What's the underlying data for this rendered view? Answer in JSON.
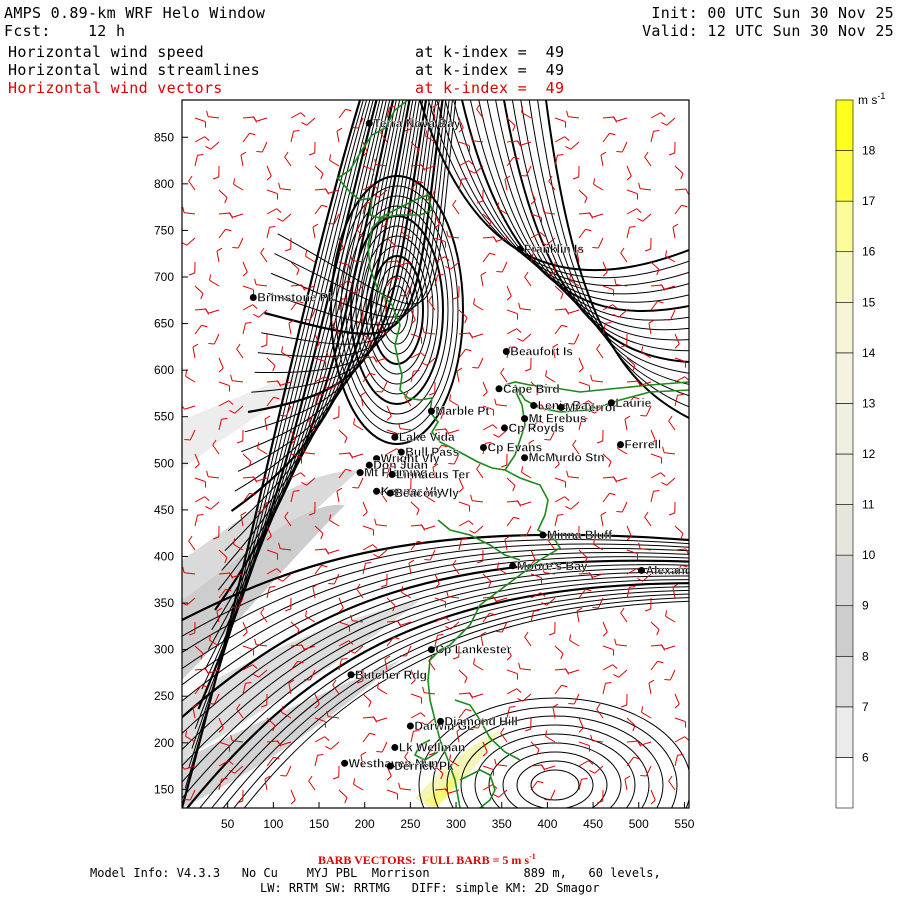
{
  "header": {
    "model_title": "AMPS 0.89-km WRF Helo Window",
    "forecast_label": "Fcst:    12 h",
    "init_label": "Init: 00 UTC Sun 30 Nov 25",
    "valid_label": "Valid: 12 UTC Sun 30 Nov 25",
    "fields": [
      {
        "name": "Horizontal wind speed",
        "level": "at k-index =  49",
        "color": "#000000"
      },
      {
        "name": "Horizontal wind streamlines",
        "level": "at k-index =  49",
        "color": "#000000"
      },
      {
        "name": "Horizontal wind vectors",
        "level": "at k-index =  49",
        "color": "#e00000"
      }
    ]
  },
  "map": {
    "x_ticks": [
      "50",
      "100",
      "150",
      "200",
      "250",
      "300",
      "350",
      "400",
      "450",
      "500",
      "550"
    ],
    "y_ticks": [
      "150",
      "200",
      "250",
      "300",
      "350",
      "400",
      "450",
      "500",
      "550",
      "600",
      "650",
      "700",
      "750",
      "800",
      "850"
    ],
    "x_range": [
      0,
      555
    ],
    "y_range": [
      130,
      890
    ],
    "coastline_color": "#1a8a1a",
    "barb_color": "#e00000",
    "streamline_color": "#000000",
    "places": [
      {
        "name": "Terra Nova Bay",
        "x": 205,
        "y": 865
      },
      {
        "name": "Franklin Is",
        "x": 370,
        "y": 730
      },
      {
        "name": "Brimstone Pk",
        "x": 78,
        "y": 678
      },
      {
        "name": "Beaufort Is",
        "x": 355,
        "y": 620
      },
      {
        "name": "Cape Bird",
        "x": 347,
        "y": 580
      },
      {
        "name": "Lenie Bay",
        "x": 385,
        "y": 562
      },
      {
        "name": "Mt Terror",
        "x": 415,
        "y": 560
      },
      {
        "name": "Laurie",
        "x": 470,
        "y": 565
      },
      {
        "name": "Marble Pt",
        "x": 273,
        "y": 556
      },
      {
        "name": "Mt Erebus",
        "x": 375,
        "y": 548
      },
      {
        "name": "Cp Royds",
        "x": 353,
        "y": 538
      },
      {
        "name": "Lake Vida",
        "x": 233,
        "y": 528
      },
      {
        "name": "Ferrell",
        "x": 480,
        "y": 520
      },
      {
        "name": "Cp Evans",
        "x": 330,
        "y": 517
      },
      {
        "name": "Bull Pass",
        "x": 240,
        "y": 512
      },
      {
        "name": "McMurdo Stn",
        "x": 375,
        "y": 506
      },
      {
        "name": "Wright Vly",
        "x": 213,
        "y": 505
      },
      {
        "name": "Don Juan",
        "x": 205,
        "y": 498
      },
      {
        "name": "Mt Fleming",
        "x": 195,
        "y": 490
      },
      {
        "name": "Linnaeus Ter",
        "x": 230,
        "y": 488
      },
      {
        "name": "Kennar Vly",
        "x": 213,
        "y": 470
      },
      {
        "name": "Beacon Vly",
        "x": 228,
        "y": 468
      },
      {
        "name": "Minna Bluff",
        "x": 395,
        "y": 423
      },
      {
        "name": "Moore's Bay",
        "x": 362,
        "y": 390
      },
      {
        "name": "Alexander",
        "x": 503,
        "y": 385
      },
      {
        "name": "Cp Lankester",
        "x": 273,
        "y": 300
      },
      {
        "name": "Butcher Rdg",
        "x": 185,
        "y": 273
      },
      {
        "name": "Darwin GL",
        "x": 250,
        "y": 218
      },
      {
        "name": "Diamond Hill",
        "x": 283,
        "y": 223
      },
      {
        "name": "Lk Wellman",
        "x": 233,
        "y": 195
      },
      {
        "name": "Westhaven Nun",
        "x": 178,
        "y": 178
      },
      {
        "name": "Derrick Pk",
        "x": 228,
        "y": 175
      }
    ]
  },
  "colorbar": {
    "unit": "m s",
    "unit_exp": "-1",
    "levels": [
      "6",
      "7",
      "8",
      "9",
      "10",
      "11",
      "12",
      "13",
      "14",
      "15",
      "16",
      "17",
      "18"
    ],
    "colors": [
      "#ffffff",
      "#ebebeb",
      "#dcdcdc",
      "#cdcdcd",
      "#d9d9d9",
      "#e6e6dc",
      "#ecece0",
      "#f0f0e2",
      "#f3f3e0",
      "#f6f6d6",
      "#f8f8c4",
      "#fbfb9a",
      "#fdfd4a",
      "#ffff1e"
    ]
  },
  "footer": {
    "barb_prefix": "BARB VECTORS:  FULL BARB = 5 m s",
    "barb_exp": "-1",
    "model_info": "Model Info: V4.3.3   No Cu    MYJ PBL  Morrison             889 m,   60 levels,",
    "physics_info": "LW: RRTM SW: RRTMG   DIFF: simple KM: 2D Smagor"
  }
}
